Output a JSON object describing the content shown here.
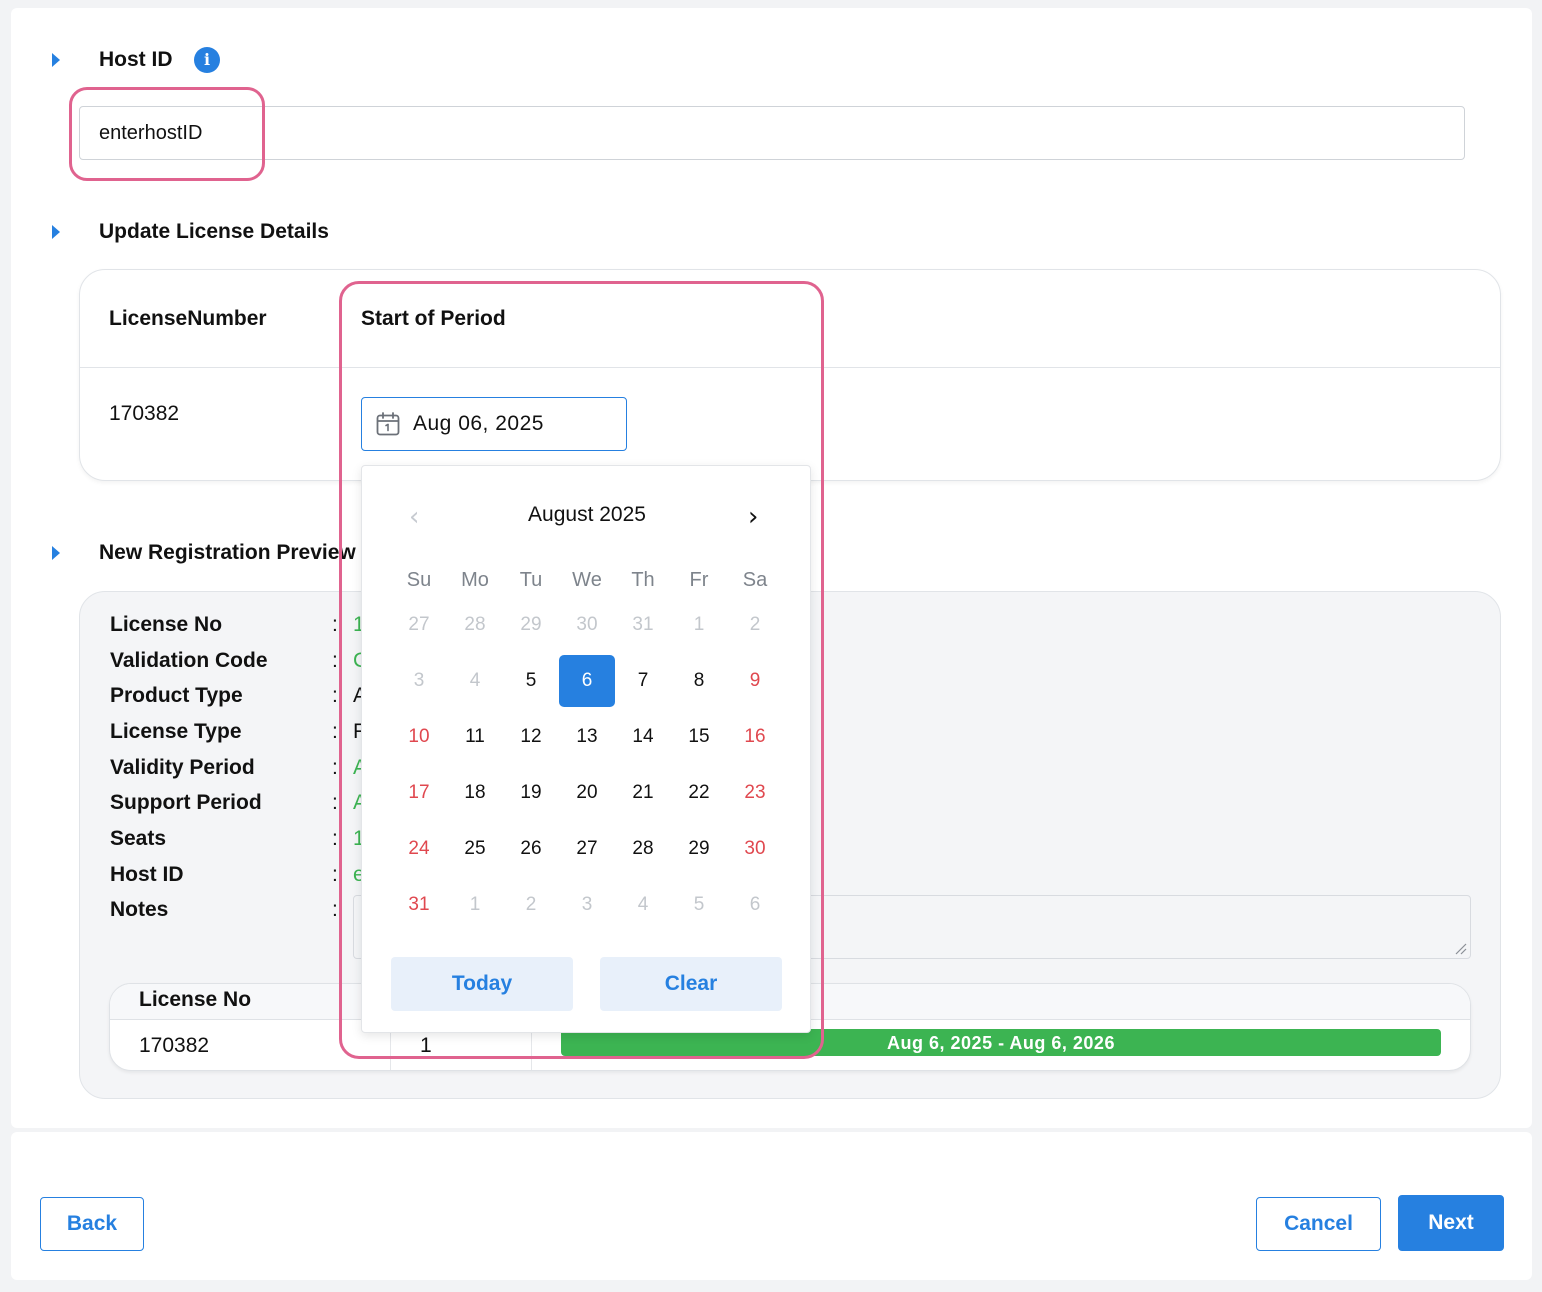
{
  "host_section": {
    "title": "Host ID",
    "input_value": "enterhostID"
  },
  "license_section": {
    "title": "Update License Details",
    "columns": [
      "LicenseNumber",
      "Start of Period"
    ],
    "license_number": "170382",
    "start_date": "Aug 06, 2025"
  },
  "calendar": {
    "month_label": "August 2025",
    "weekdays": [
      "Su",
      "Mo",
      "Tu",
      "We",
      "Th",
      "Fr",
      "Sa"
    ],
    "weeks": [
      [
        "27",
        "28",
        "29",
        "30",
        "31",
        "1",
        "2"
      ],
      [
        "3",
        "4",
        "5",
        "6",
        "7",
        "8",
        "9"
      ],
      [
        "10",
        "11",
        "12",
        "13",
        "14",
        "15",
        "16"
      ],
      [
        "17",
        "18",
        "19",
        "20",
        "21",
        "22",
        "23"
      ],
      [
        "24",
        "25",
        "26",
        "27",
        "28",
        "29",
        "30"
      ],
      [
        "31",
        "1",
        "2",
        "3",
        "4",
        "5",
        "6"
      ]
    ],
    "selected_day": "6",
    "today_label": "Today",
    "clear_label": "Clear"
  },
  "preview_section": {
    "title": "New Registration Preview",
    "fields": [
      {
        "label": "License No",
        "value": "1"
      },
      {
        "label": "Validation Code",
        "value": "C"
      },
      {
        "label": "Product Type",
        "value": "A"
      },
      {
        "label": "License Type",
        "value": "F"
      },
      {
        "label": "Validity Period",
        "value": "A"
      },
      {
        "label": "Support Period",
        "value": "A"
      },
      {
        "label": "Seats",
        "value": "1"
      },
      {
        "label": "Host ID",
        "value": "e"
      },
      {
        "label": "Notes",
        "value": ""
      }
    ],
    "table": {
      "header": "License No",
      "license_no": "170382",
      "seats": "1",
      "period": "Aug 6, 2025 - Aug 6, 2026"
    }
  },
  "footer": {
    "back_label": "Back",
    "cancel_label": "Cancel",
    "next_label": "Next"
  },
  "colors": {
    "accent": "#2680e0",
    "success": "#3cb452",
    "weekend": "#e0484f",
    "highlight": "#e0638f"
  }
}
